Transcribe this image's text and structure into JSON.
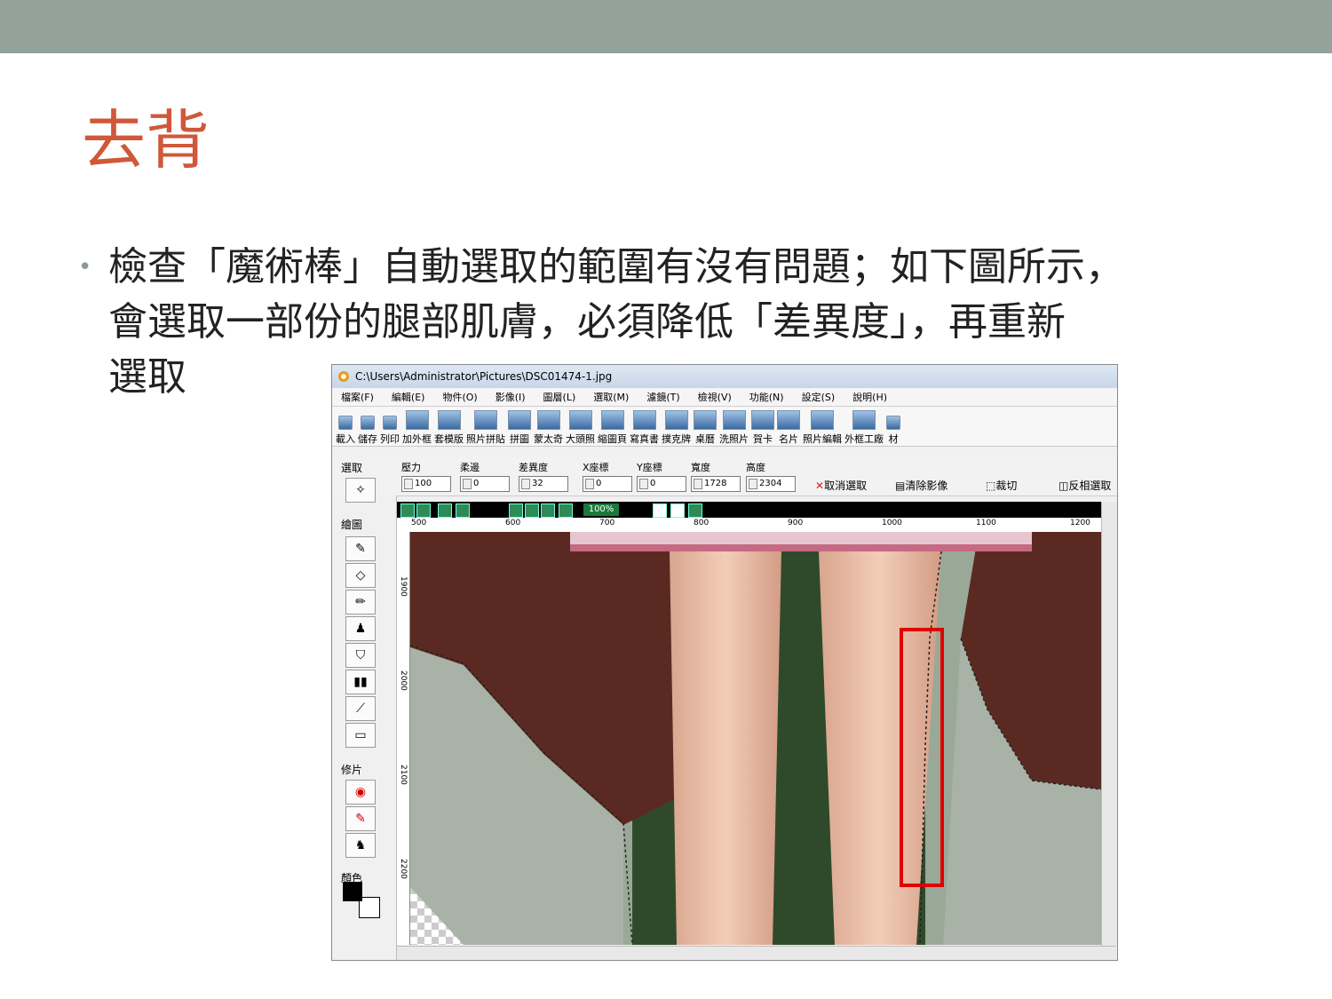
{
  "slide": {
    "title": "去背",
    "bullet_lines": [
      "檢查「魔術棒」自動選取的範圍有沒有問題；如下圖所示，",
      "會選取一部份的腿部肌膚，必須降低「差異度」，再重新",
      "選取"
    ]
  },
  "app": {
    "window_title": "C:\\Users\\Administrator\\Pictures\\DSC01474-1.jpg",
    "menu": [
      "檔案(F)",
      "編輯(E)",
      "物件(O)",
      "影像(I)",
      "圖層(L)",
      "選取(M)",
      "濾鏡(T)",
      "檢視(V)",
      "功能(N)",
      "設定(S)",
      "說明(H)"
    ],
    "toolbar": [
      "載入",
      "儲存",
      "列印",
      "加外框",
      "套模版",
      "照片拼貼",
      "拼圖",
      "蒙太奇",
      "大頭照",
      "縮圖頁",
      "寫真書",
      "撲克牌",
      "桌曆",
      "洗照片",
      "賀卡",
      "名片",
      "照片編輯",
      "外框工廠",
      "材"
    ],
    "options": {
      "labels": [
        "壓力",
        "柔邊",
        "差異度",
        "X座標",
        "Y座標",
        "寬度",
        "高度"
      ],
      "values": [
        "100",
        "0",
        "32",
        "0",
        "0",
        "1728",
        "2304"
      ],
      "actions": {
        "deselect": "取消選取",
        "clear": "清除影像",
        "crop": "裁切",
        "invert": "反相選取"
      }
    },
    "side_sections": {
      "select": "選取",
      "draw": "繪圖",
      "retouch": "修片",
      "color": "顏色"
    },
    "zoom": "100%",
    "ruler_h": [
      "500",
      "600",
      "700",
      "800",
      "900",
      "1000",
      "1100",
      "1200"
    ],
    "ruler_v": [
      "1900",
      "2000",
      "2100",
      "2200"
    ]
  }
}
